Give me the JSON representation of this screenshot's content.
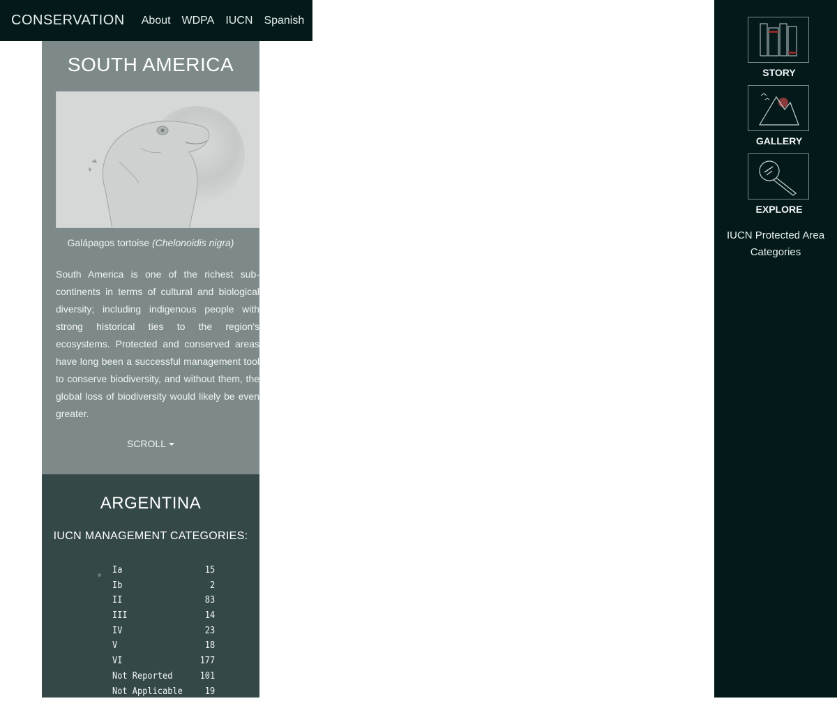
{
  "nav": {
    "brand": "CONSERVATION",
    "links": [
      "About",
      "WDPA",
      "IUCN",
      "Spanish"
    ]
  },
  "intro": {
    "title": "SOUTH AMERICA",
    "caption_common": "Galápagos tortoise ",
    "caption_scientific": "(Chelonoidis nigra)",
    "description": "South America is one of the richest sub-continents in terms of cultural and biological diversity; including indigenous people with strong historical ties to the region's ecosystems. Protected and conserved areas have long been a successful management tool to conserve biodiversity, and without them, the global loss of biodiversity would likely be even greater.",
    "scroll_label": "SCROLL"
  },
  "country": {
    "name": "ARGENTINA",
    "heading": "IUCN MANAGEMENT CATEGORIES:",
    "categories": [
      {
        "label": "Ia",
        "count": "15"
      },
      {
        "label": "Ib",
        "count": "2"
      },
      {
        "label": "II",
        "count": "83"
      },
      {
        "label": "III",
        "count": "14"
      },
      {
        "label": "IV",
        "count": "23"
      },
      {
        "label": "V",
        "count": "18"
      },
      {
        "label": "VI",
        "count": "177"
      },
      {
        "label": "Not Reported",
        "count": "101"
      },
      {
        "label": "Not Applicable",
        "count": "19"
      }
    ]
  },
  "sidebar": {
    "story_label": "STORY",
    "gallery_label": "GALLERY",
    "explore_label": "EXPLORE",
    "iucn_link": "IUCN Protected Area Categories"
  },
  "colors": {
    "navbar_bg": "#041a1a",
    "intro_bg": "#7e8a8a",
    "country_bg": "#344848",
    "sidebar_bg": "#041a1a"
  },
  "icons": {
    "hero_image": "tortoise-sketch-image",
    "story": "books-icon",
    "gallery": "mountain-icon",
    "explore": "magnifier-icon"
  }
}
